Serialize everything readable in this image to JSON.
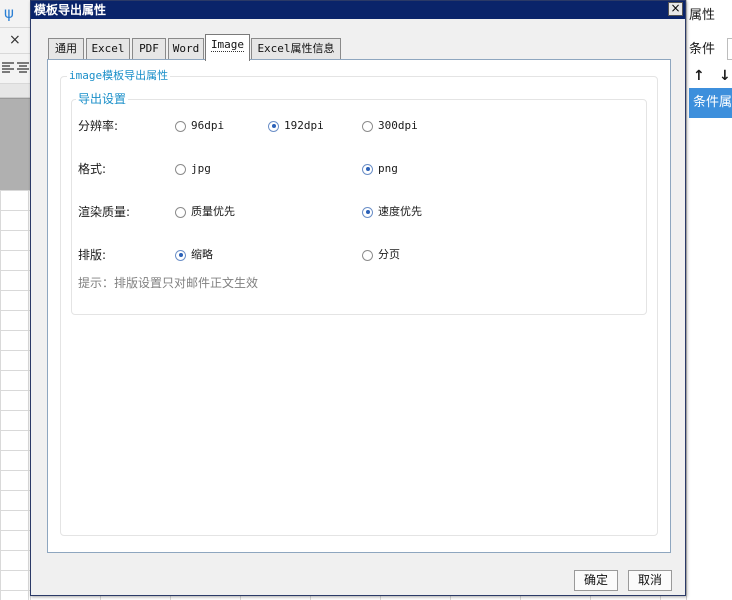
{
  "background": {
    "left_icon": "ψ",
    "left_close": "×",
    "right_label_top": "属性",
    "right_label_condition": "条件",
    "right_arrows": [
      "↑",
      "↓"
    ],
    "right_selected_item": "条件属性"
  },
  "dialog": {
    "title": "模板导出属性",
    "close_glyph": "×",
    "tabs": [
      {
        "label": "通用",
        "active": false
      },
      {
        "label": "Excel",
        "active": false
      },
      {
        "label": "PDF",
        "active": false
      },
      {
        "label": "Word",
        "active": false
      },
      {
        "label": "Image",
        "active": true
      },
      {
        "label": "Excel属性信息",
        "active": false
      }
    ],
    "group_title": "image模板导出属性",
    "subgroup_title": "导出设置",
    "rows": [
      {
        "label": "分辨率:",
        "options": [
          {
            "text": "96dpi",
            "checked": false
          },
          {
            "text": "192dpi",
            "checked": true
          },
          {
            "text": "300dpi",
            "checked": false
          }
        ]
      },
      {
        "label": "格式:",
        "options": [
          {
            "text": "jpg",
            "checked": false
          },
          {
            "text": "png",
            "checked": true
          }
        ]
      },
      {
        "label": "渲染质量:",
        "options": [
          {
            "text": "质量优先",
            "checked": false
          },
          {
            "text": "速度优先",
            "checked": true
          }
        ]
      },
      {
        "label": "排版:",
        "options": [
          {
            "text": "缩略",
            "checked": true
          },
          {
            "text": "分页",
            "checked": false
          }
        ]
      }
    ],
    "hint": "提示：排版设置只对邮件正文生效",
    "buttons": {
      "ok": "确定",
      "cancel": "取消"
    }
  },
  "colors": {
    "titlebar": "#0a246a",
    "accent": "#1a8fc9",
    "selection": "#3d8fdc"
  }
}
